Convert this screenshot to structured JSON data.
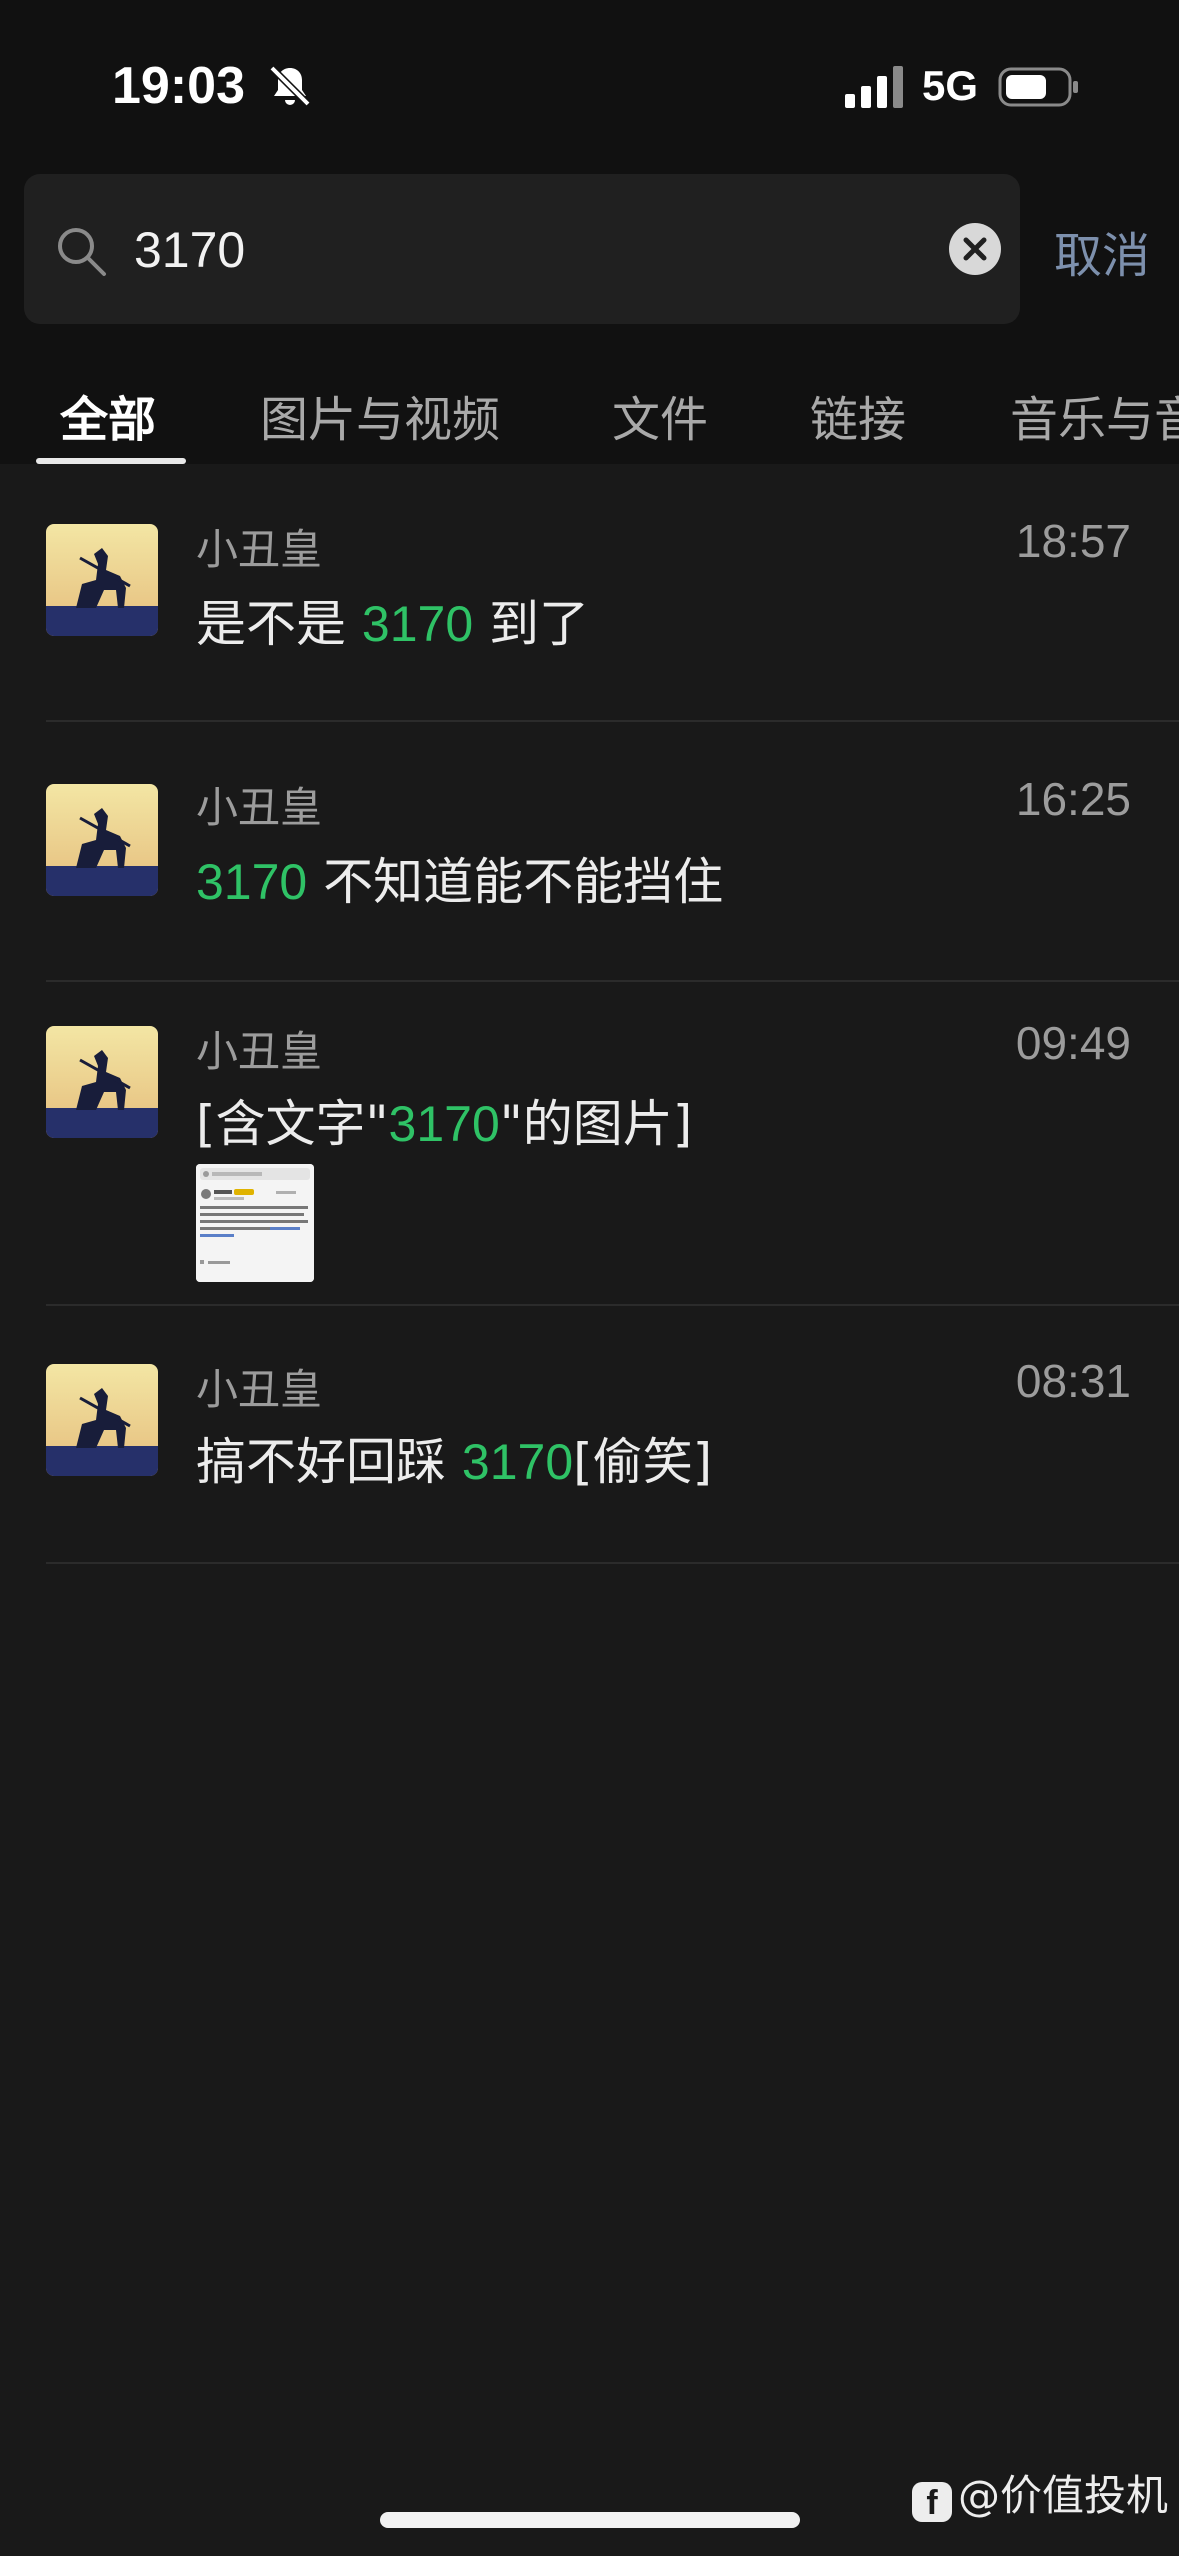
{
  "status": {
    "time": "19:03",
    "network": "5G"
  },
  "search": {
    "query": "3170",
    "cancel_label": "取消"
  },
  "tabs": [
    {
      "label": "全部",
      "active": true
    },
    {
      "label": "图片与视频",
      "active": false
    },
    {
      "label": "文件",
      "active": false
    },
    {
      "label": "链接",
      "active": false
    },
    {
      "label": "音乐与音",
      "active": false
    }
  ],
  "results": [
    {
      "sender": "小丑皇",
      "time": "18:57",
      "msg_pre": "是不是 ",
      "msg_hl": "3170",
      "msg_post": " 到了"
    },
    {
      "sender": "小丑皇",
      "time": "16:25",
      "msg_pre": "",
      "msg_hl": "3170",
      "msg_post": " 不知道能不能挡住"
    },
    {
      "sender": "小丑皇",
      "time": "09:49",
      "msg_pre": "[含文字\"",
      "msg_hl": "3170",
      "msg_post": "\"的图片]"
    },
    {
      "sender": "小丑皇",
      "time": "08:31",
      "msg_pre": "搞不好回踩 ",
      "msg_hl": "3170",
      "msg_post": "[偷笑]"
    }
  ],
  "watermark": {
    "text": "@价值投机"
  },
  "colors": {
    "highlight": "#2fc266",
    "cancel": "#7d90ad",
    "background": "#191919"
  }
}
